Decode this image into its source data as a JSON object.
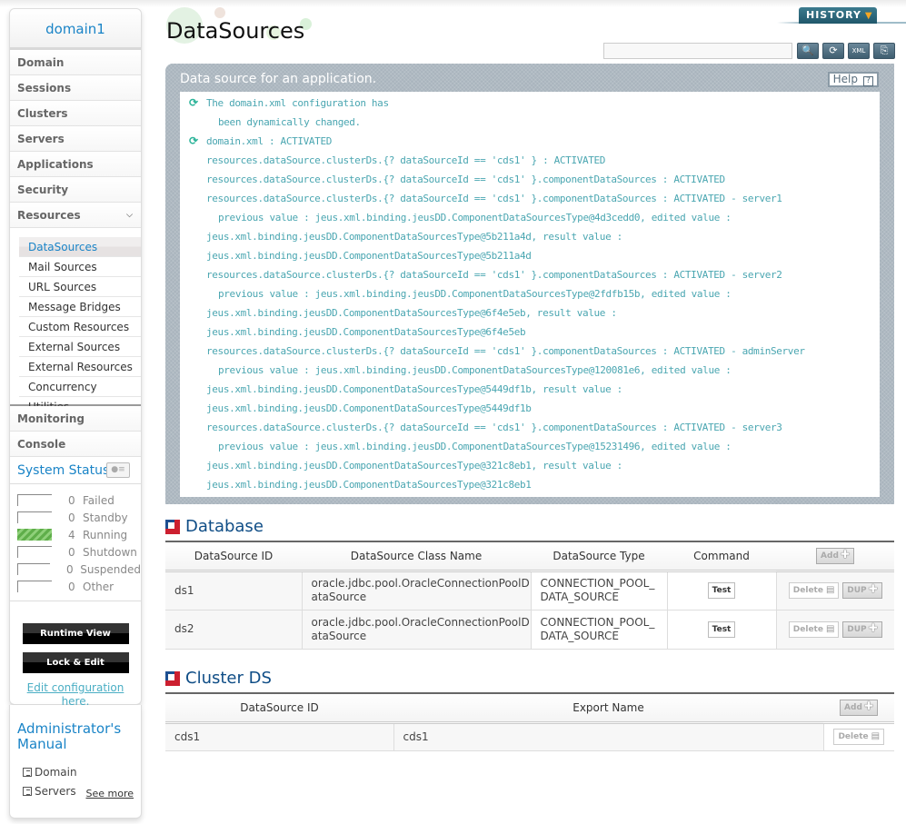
{
  "sidebar": {
    "domain_title": "domain1",
    "nav": [
      {
        "label": "Domain"
      },
      {
        "label": "Sessions"
      },
      {
        "label": "Clusters"
      },
      {
        "label": "Servers"
      },
      {
        "label": "Applications"
      },
      {
        "label": "Security"
      },
      {
        "label": "Resources",
        "icon": "chevron-down-icon"
      }
    ],
    "resources_sub": [
      {
        "label": "DataSources",
        "active": true
      },
      {
        "label": "Mail Sources"
      },
      {
        "label": "URL Sources"
      },
      {
        "label": "Message Bridges"
      },
      {
        "label": "Custom Resources"
      },
      {
        "label": "External Sources"
      },
      {
        "label": "External Resources"
      },
      {
        "label": "Concurrency Utilities"
      }
    ],
    "nav_bottom": [
      {
        "label": "Monitoring"
      },
      {
        "label": "Console"
      }
    ],
    "system_status": {
      "title": "System Status",
      "rows": [
        {
          "count": "0",
          "label": "Failed"
        },
        {
          "count": "0",
          "label": "Standby"
        },
        {
          "count": "4",
          "label": "Running"
        },
        {
          "count": "0",
          "label": "Shutdown"
        },
        {
          "count": "0",
          "label": "Suspended"
        },
        {
          "count": "0",
          "label": "Other"
        }
      ]
    },
    "buttons": {
      "runtime_view": "Runtime View",
      "lock_edit": "Lock & Edit",
      "edit_link_line1": "Edit configuration",
      "edit_link_line2": "here."
    },
    "manual": {
      "title_line1": "Administrator's",
      "title_line2": "Manual",
      "items": [
        {
          "label": "Domain"
        },
        {
          "label": "Servers"
        }
      ],
      "see_more": "See more"
    }
  },
  "header": {
    "page_title": "DataSources",
    "history_label": "HISTORY",
    "search": {
      "value": "",
      "placeholder": ""
    },
    "tools": [
      "search-icon",
      "refresh-icon",
      "xml-export-icon",
      "report-icon"
    ]
  },
  "info": {
    "title": "Data source for an application.",
    "help_label": "Help",
    "log": [
      {
        "text": "The domain.xml configuration has",
        "icon": true
      },
      {
        "text": "been dynamically changed.",
        "indent": 2
      },
      {
        "text": "domain.xml : ACTIVATED",
        "icon": true
      },
      {
        "text": "resources.dataSource.clusterDs.{? dataSourceId == 'cds1' } : ACTIVATED",
        "indent": 1
      },
      {
        "text": "resources.dataSource.clusterDs.{? dataSourceId == 'cds1' }.componentDataSources : ACTIVATED",
        "indent": 1
      },
      {
        "text": "resources.dataSource.clusterDs.{? dataSourceId == 'cds1' }.componentDataSources : ACTIVATED - server1",
        "indent": 1
      },
      {
        "text": "previous value : jeus.xml.binding.jeusDD.ComponentDataSourcesType@4d3cedd0, edited value :",
        "indent": 2
      },
      {
        "text": "jeus.xml.binding.jeusDD.ComponentDataSourcesType@5b211a4d, result value :",
        "indent": 1
      },
      {
        "text": "jeus.xml.binding.jeusDD.ComponentDataSourcesType@5b211a4d",
        "indent": 1
      },
      {
        "text": "resources.dataSource.clusterDs.{? dataSourceId == 'cds1' }.componentDataSources : ACTIVATED - server2",
        "indent": 1
      },
      {
        "text": "previous value : jeus.xml.binding.jeusDD.ComponentDataSourcesType@2fdfb15b, edited value :",
        "indent": 2
      },
      {
        "text": "jeus.xml.binding.jeusDD.ComponentDataSourcesType@6f4e5eb, result value :",
        "indent": 1
      },
      {
        "text": "jeus.xml.binding.jeusDD.ComponentDataSourcesType@6f4e5eb",
        "indent": 1
      },
      {
        "text": "resources.dataSource.clusterDs.{? dataSourceId == 'cds1' }.componentDataSources : ACTIVATED - adminServer",
        "indent": 1
      },
      {
        "text": "previous value : jeus.xml.binding.jeusDD.ComponentDataSourcesType@120081e6, edited value :",
        "indent": 2
      },
      {
        "text": "jeus.xml.binding.jeusDD.ComponentDataSourcesType@5449df1b, result value :",
        "indent": 1
      },
      {
        "text": "jeus.xml.binding.jeusDD.ComponentDataSourcesType@5449df1b",
        "indent": 1
      },
      {
        "text": "resources.dataSource.clusterDs.{? dataSourceId == 'cds1' }.componentDataSources : ACTIVATED - server3",
        "indent": 1
      },
      {
        "text": "previous value : jeus.xml.binding.jeusDD.ComponentDataSourcesType@15231496, edited value :",
        "indent": 2
      },
      {
        "text": "jeus.xml.binding.jeusDD.ComponentDataSourcesType@321c8eb1, result value :",
        "indent": 1
      },
      {
        "text": "jeus.xml.binding.jeusDD.ComponentDataSourcesType@321c8eb1",
        "indent": 1
      }
    ]
  },
  "database": {
    "title": "Database",
    "columns": [
      "DataSource ID",
      "DataSource Class Name",
      "DataSource Type",
      "Command"
    ],
    "add_label": "Add",
    "rows": [
      {
        "id": "ds1",
        "class_line1": "oracle.jdbc.pool.OracleConnectionPoolD",
        "class_line2": "ataSource",
        "type_line1": "CONNECTION_POOL_",
        "type_line2": "DATA_SOURCE",
        "command": "Test",
        "delete": "Delete",
        "dup": "DUP"
      },
      {
        "id": "ds2",
        "class_line1": "oracle.jdbc.pool.OracleConnectionPoolD",
        "class_line2": "ataSource",
        "type_line1": "CONNECTION_POOL_",
        "type_line2": "DATA_SOURCE",
        "command": "Test",
        "delete": "Delete",
        "dup": "DUP"
      }
    ]
  },
  "cluster_ds": {
    "title": "Cluster DS",
    "columns": [
      "DataSource ID",
      "Export Name"
    ],
    "add_label": "Add",
    "rows": [
      {
        "id": "cds1",
        "export_name": "cds1",
        "delete": "Delete"
      }
    ]
  },
  "colors": {
    "accent_blue": "#1a84c7",
    "section_title": "#0f4d86",
    "log_text": "#4aa6b1",
    "running_green": "#5fae4a",
    "history_bg": "#2b6478"
  }
}
